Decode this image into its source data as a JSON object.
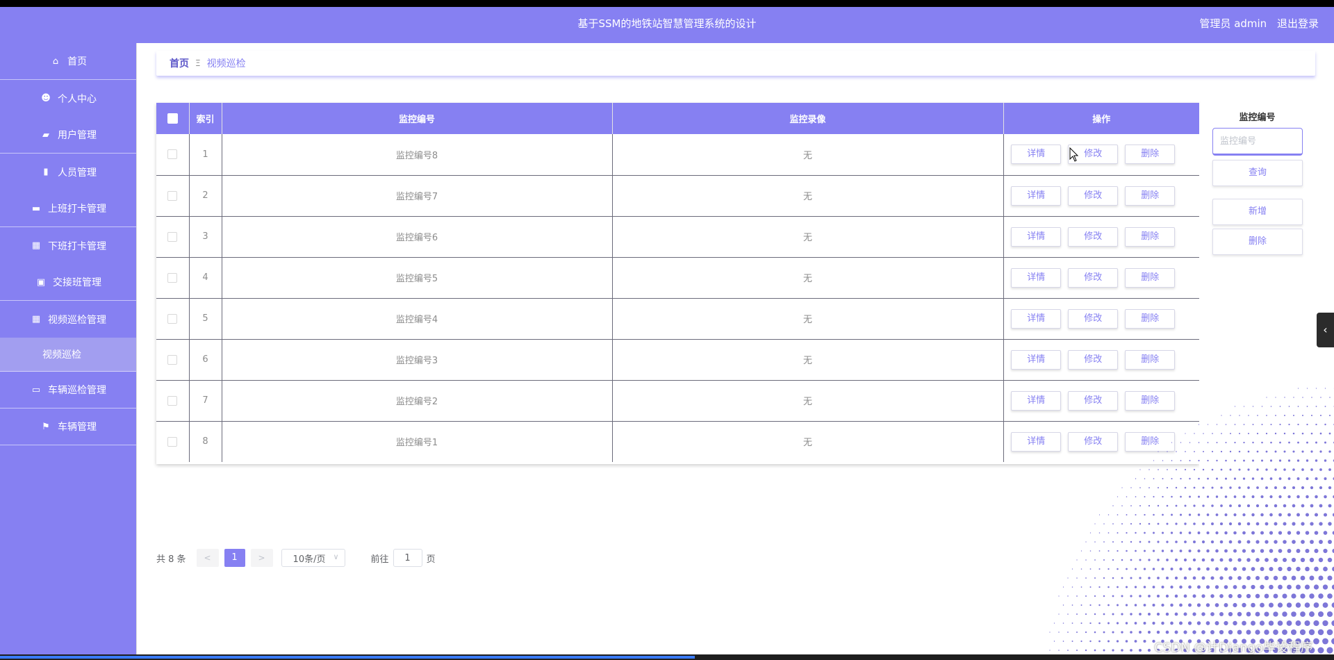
{
  "header": {
    "title": "基于SSM的地铁站智慧管理系统的设计",
    "role": "管理员 admin",
    "logout": "退出登录",
    "bg_color": "#8680f2"
  },
  "sidebar": {
    "items": [
      {
        "label": "首页",
        "icon": "home-icon",
        "glyph": "⌂"
      },
      {
        "label": "个人中心",
        "icon": "user-icon",
        "glyph": "☻"
      },
      {
        "label": "用户管理",
        "icon": "briefcase-icon",
        "glyph": "▰"
      },
      {
        "label": "人员管理",
        "icon": "bar-chart-icon",
        "glyph": "▮"
      },
      {
        "label": "上班打卡管理",
        "icon": "wallet-icon",
        "glyph": "▬"
      },
      {
        "label": "下班打卡管理",
        "icon": "grid-icon",
        "glyph": "▦"
      },
      {
        "label": "交接班管理",
        "icon": "clipboard-icon",
        "glyph": "▣"
      },
      {
        "label": "视频巡检管理",
        "icon": "grid-icon",
        "glyph": "▦"
      },
      {
        "label": "视频巡检",
        "icon": "",
        "glyph": ""
      },
      {
        "label": "车辆巡检管理",
        "icon": "laptop-icon",
        "glyph": "▭"
      },
      {
        "label": "车辆管理",
        "icon": "flag-icon",
        "glyph": "⚑"
      }
    ]
  },
  "breadcrumb": {
    "home": "首页",
    "separator": "Ξ",
    "current": "视频巡检"
  },
  "table": {
    "columns": [
      "索引",
      "监控编号",
      "监控录像",
      "操作"
    ],
    "rows": [
      {
        "index": "1",
        "code": "监控编号8",
        "video": "无"
      },
      {
        "index": "2",
        "code": "监控编号7",
        "video": "无"
      },
      {
        "index": "3",
        "code": "监控编号6",
        "video": "无"
      },
      {
        "index": "4",
        "code": "监控编号5",
        "video": "无"
      },
      {
        "index": "5",
        "code": "监控编号4",
        "video": "无"
      },
      {
        "index": "6",
        "code": "监控编号3",
        "video": "无"
      },
      {
        "index": "7",
        "code": "监控编号2",
        "video": "无"
      },
      {
        "index": "8",
        "code": "监控编号1",
        "video": "无"
      }
    ],
    "actions": {
      "detail": "详情",
      "edit": "修改",
      "delete": "删除"
    }
  },
  "search": {
    "label": "监控编号",
    "placeholder": "监控编号",
    "query_btn": "查询",
    "add_btn": "新增",
    "delete_btn": "删除"
  },
  "pagination": {
    "total": "共 8 条",
    "prev": "<",
    "current": "1",
    "next": ">",
    "page_size": "10条/页",
    "goto_prefix": "前往",
    "goto_value": "1",
    "goto_suffix": "页"
  },
  "watermark": "CSDN @计Django毕设程序"
}
